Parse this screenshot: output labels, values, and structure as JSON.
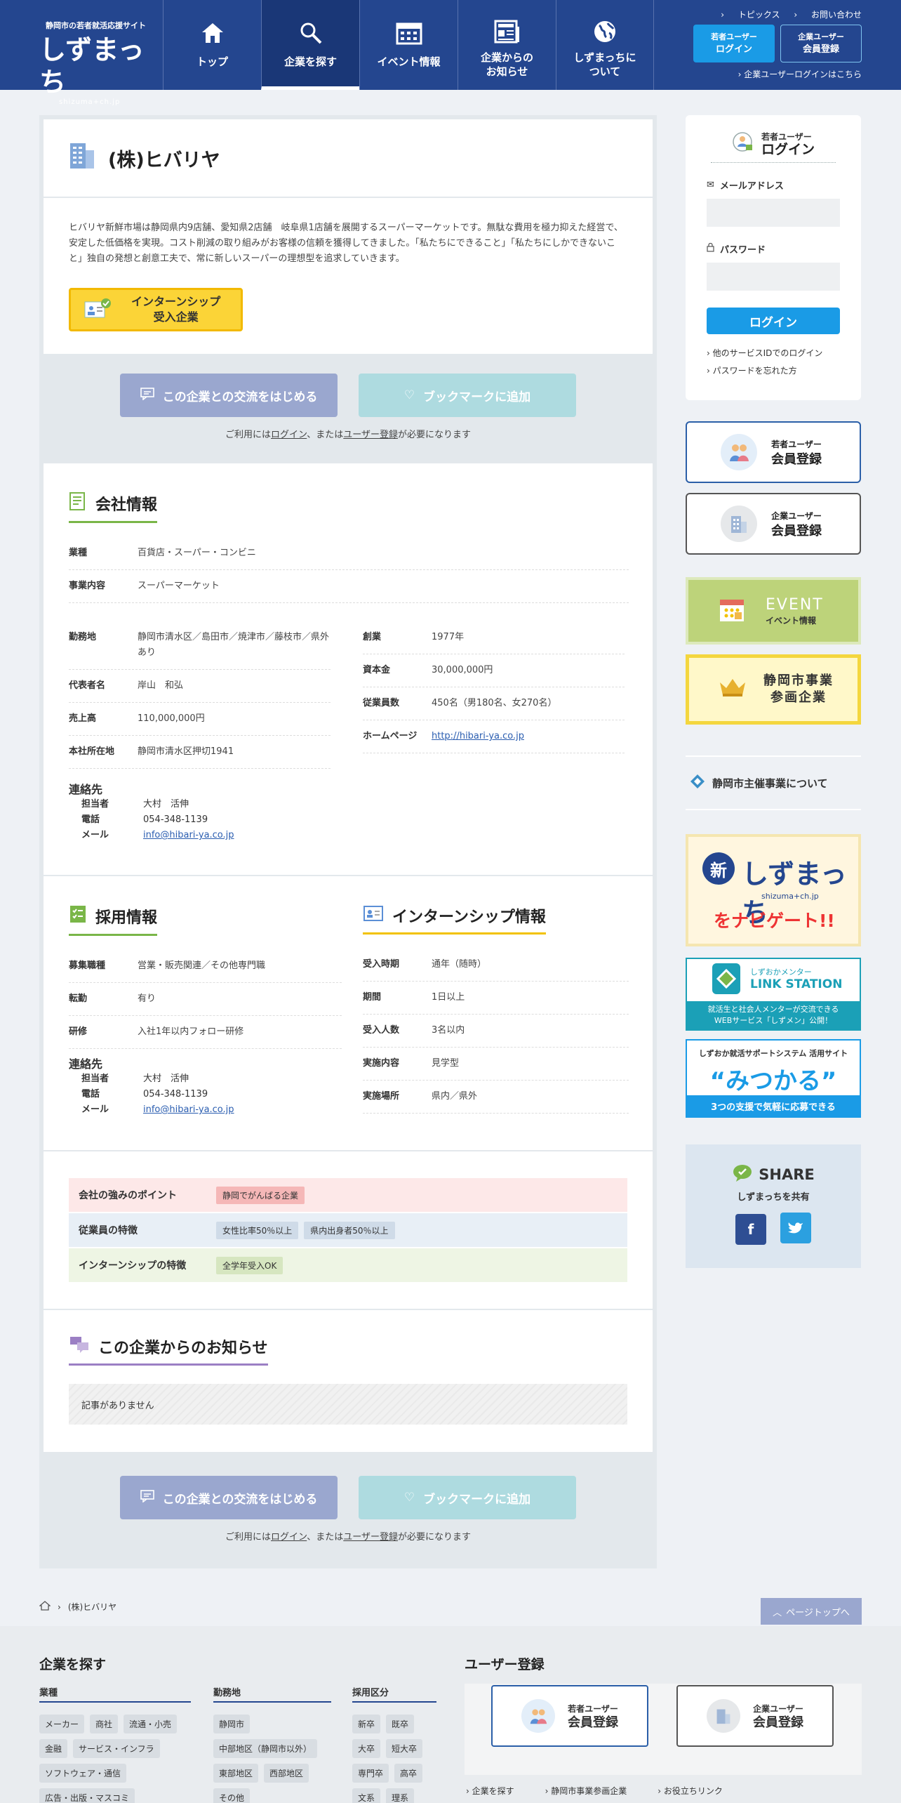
{
  "header": {
    "tagline": "静岡市の若者就活応援サイト",
    "logo": "しずまっち",
    "logo_sub": "shizuma+ch.jp",
    "nav": [
      "トップ",
      "企業を探す",
      "イベント情報",
      "企業からの\nお知らせ",
      "しずまっちに\nついて"
    ],
    "links": {
      "topics": "トピックス",
      "contact": "お問い合わせ"
    },
    "young_login": {
      "top": "若者ユーザー",
      "main": "ログイン"
    },
    "corp_register": {
      "top": "企業ユーザー",
      "main": "会員登録"
    },
    "corp_login_link": "企業ユーザーログインはこちら"
  },
  "company": {
    "name": "(株)ヒバリヤ",
    "description": "ヒバリヤ新鮮市場は静岡県内9店舗、愛知県2店舗　岐阜県1店舗を展開するスーパーマーケットです。無駄な費用を極力抑えた経営で、安定した低価格を実現。コスト削減の取り組みがお客様の信頼を獲得してきました。「私たちにできること」「私たちにしかできないこと」独自の発想と創意工夫で、常に新しいスーパーの理想型を追求していきます。",
    "badge": "インターンシップ\n受入企業"
  },
  "actions": {
    "talk": "この企業との交流をはじめる",
    "bookmark": "ブックマークに追加",
    "note_pre": "ご利用には",
    "note_login": "ログイン",
    "note_mid": "、または",
    "note_reg": "ユーザー登録",
    "note_post": "が必要になります"
  },
  "company_info": {
    "heading": "会社情報",
    "full_rows": [
      {
        "k": "業種",
        "v": "百貨店・スーパー・コンビニ"
      },
      {
        "k": "事業内容",
        "v": "スーパーマーケット"
      }
    ],
    "left_rows": [
      {
        "k": "勤務地",
        "v": "静岡市清水区／島田市／焼津市／藤枝市／県外あり"
      },
      {
        "k": "代表者名",
        "v": "岸山　和弘"
      },
      {
        "k": "売上高",
        "v": "110,000,000円"
      },
      {
        "k": "本社所在地",
        "v": "静岡市清水区押切1941"
      }
    ],
    "right_rows": [
      {
        "k": "創業",
        "v": "1977年"
      },
      {
        "k": "資本金",
        "v": "30,000,000円"
      },
      {
        "k": "従業員数",
        "v": "450名（男180名、女270名）"
      },
      {
        "k": "ホームページ",
        "v": "http://hibari-ya.co.jp"
      }
    ],
    "contact": {
      "heading": "連絡先",
      "rows": [
        {
          "k": "担当者",
          "v": "大村　活伸"
        },
        {
          "k": "電話",
          "v": "054-348-1139"
        },
        {
          "k": "メール",
          "v": "info@hibari-ya.co.jp"
        }
      ]
    }
  },
  "recruit": {
    "heading": "採用情報",
    "rows": [
      {
        "k": "募集職種",
        "v": "営業・販売関連／その他専門職"
      },
      {
        "k": "転勤",
        "v": "有り"
      },
      {
        "k": "研修",
        "v": "入社1年以内フォロー研修"
      }
    ],
    "contact": {
      "heading": "連絡先",
      "rows": [
        {
          "k": "担当者",
          "v": "大村　活伸"
        },
        {
          "k": "電話",
          "v": "054-348-1139"
        },
        {
          "k": "メール",
          "v": "info@hibari-ya.co.jp"
        }
      ]
    }
  },
  "internship": {
    "heading": "インターンシップ情報",
    "rows": [
      {
        "k": "受入時期",
        "v": "通年（随時）"
      },
      {
        "k": "期間",
        "v": "1日以上"
      },
      {
        "k": "受入人数",
        "v": "3名以内"
      },
      {
        "k": "実施内容",
        "v": "見学型"
      },
      {
        "k": "実施場所",
        "v": "県内／県外"
      }
    ]
  },
  "features": [
    {
      "k": "会社の強みのポイント",
      "tags": [
        "静岡でがんばる企業"
      ],
      "bg": "#fde8e8",
      "tag_bg": "#f5b7b7"
    },
    {
      "k": "従業員の特徴",
      "tags": [
        "女性比率50％以上",
        "県内出身者50％以上"
      ],
      "bg": "#e8eff6",
      "tag_bg": "#cfdbe8"
    },
    {
      "k": "インターンシップの特徴",
      "tags": [
        "全学年受入OK"
      ],
      "bg": "#eef5e4",
      "tag_bg": "#d6e6c0"
    }
  ],
  "news": {
    "heading": "この企業からのお知らせ",
    "empty": "記事がありません"
  },
  "sidebar": {
    "login": {
      "top": "若者ユーザー",
      "main": "ログイン",
      "email": "メールアドレス",
      "password": "パスワード",
      "button": "ログイン",
      "other": "他のサービスIDでのログイン",
      "forgot": "パスワードを忘れた方"
    },
    "young_reg": {
      "top": "若者ユーザー",
      "main": "会員登録"
    },
    "corp_reg": {
      "top": "企業ユーザー",
      "main": "会員登録"
    },
    "event": {
      "main": "EVENT",
      "sub": "イベント情報"
    },
    "jigyo": "静岡市事業\n参画企業",
    "about": "静岡市主催事業について",
    "banner1": {
      "kanji": "新",
      "logo": "しずまっち",
      "sub": "shizuma+ch.jp",
      "nav": "をナビゲート!!"
    },
    "banner2": {
      "line1": "しずおかメンター",
      "line2": "LINK STATION",
      "line3": "就活生と社会人メンターが交流できる",
      "line4": "WEBサービス「しずメン」公開！"
    },
    "banner3": {
      "line1": "しずおか就活サポートシステム 活用サイト",
      "line2": "“みつかる”",
      "line3": "3つの支援で気軽に応募できる"
    },
    "share": {
      "title": "SHARE",
      "sub": "しずまっちを共有"
    }
  },
  "breadcrumb": {
    "current": "(株)ヒバリヤ"
  },
  "pagetop": "ページトップへ",
  "footer": {
    "search_heading": "企業を探す",
    "reg_heading": "ユーザー登録",
    "cat1": {
      "title": "業種",
      "items": [
        "メーカー",
        "商社",
        "流通・小売",
        "金融",
        "サービス・インフラ",
        "ソフトウェア・通信",
        "広告・出版・マスコミ"
      ]
    },
    "cat2": {
      "title": "勤務地",
      "items": [
        "静岡市",
        "中部地区（静岡市以外）",
        "東部地区",
        "西部地区",
        "その他"
      ]
    },
    "cat3": {
      "title": "採用区分",
      "items": [
        "新卒",
        "既卒",
        "大卒",
        "短大卒",
        "専門卒",
        "高卒",
        "文系",
        "理系"
      ]
    },
    "young_reg": {
      "top": "若者ユーザー",
      "main": "会員登録"
    },
    "corp_reg": {
      "top": "企業ユーザー",
      "main": "会員登録"
    },
    "links": [
      "企業を探す",
      "静岡市事業参画企業",
      "お役立ちリンク"
    ]
  },
  "colors": {
    "header": "#24468f",
    "accent": "#1a9be6"
  }
}
